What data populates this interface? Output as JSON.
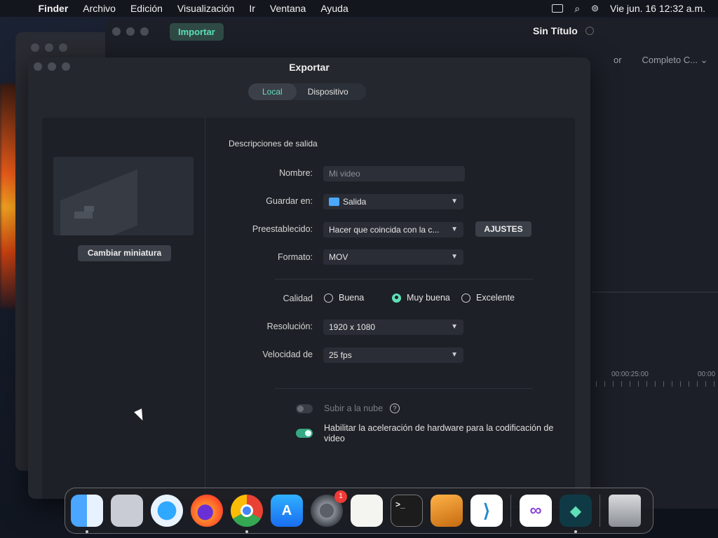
{
  "menubar": {
    "app_name": "Finder",
    "items": [
      "Archivo",
      "Edición",
      "Visualización",
      "Ir",
      "Ventana",
      "Ayuda"
    ],
    "clock": "Vie jun. 16  12:32 a.m."
  },
  "app": {
    "import_label": "Importar",
    "title": "Sin Título",
    "preview_label": "Completo C...",
    "preview_label_prefix": "or",
    "timecode_1": "00:00:25:00",
    "timecode_2": "00:00"
  },
  "dialog": {
    "title": "Exportar",
    "tabs": [
      {
        "label": "Local",
        "active": true
      },
      {
        "label": "Dispositivo",
        "active": false
      }
    ],
    "change_thumbnail_label": "Cambiar miniatura",
    "section_title": "Descripciones de salida",
    "fields": {
      "name": {
        "label": "Nombre:",
        "placeholder": "Mi video"
      },
      "save_in": {
        "label": "Guardar en:",
        "value": "Salida"
      },
      "preset": {
        "label": "Preestablecido:",
        "value": "Hacer que coincida con la c..."
      },
      "format": {
        "label": "Formato:",
        "value": "MOV"
      },
      "resolution": {
        "label": "Resolución:",
        "value": "1920 x 1080"
      },
      "frame_rate": {
        "label": "Velocidad de",
        "value": "25 fps"
      }
    },
    "settings_button": "AJUSTES",
    "quality": {
      "label": "Calidad",
      "options": [
        {
          "label": "Buena",
          "selected": false
        },
        {
          "label": "Muy buena",
          "selected": true
        },
        {
          "label": "Excelente",
          "selected": false
        }
      ]
    },
    "toggles": {
      "cloud_upload": {
        "label": "Subir a la nube",
        "enabled": false
      },
      "hw_accel": {
        "label": "Habilitar la aceleración de hardware para la codificación de video",
        "enabled": true
      }
    }
  },
  "dock": {
    "items": [
      "finder-icon",
      "launchpad-icon",
      "safari-icon",
      "firefox-icon",
      "chrome-icon",
      "app-store-icon",
      "system-settings-icon",
      "textedit-icon",
      "terminal-icon",
      "instruments-icon",
      "vscode-icon",
      "visual-studio-icon",
      "filmora-icon",
      "trash-icon"
    ],
    "settings_badge": "1"
  },
  "colors": {
    "accent": "#5fe0b8",
    "dialog_bg": "#24272e",
    "badge": "#ef3b36"
  }
}
